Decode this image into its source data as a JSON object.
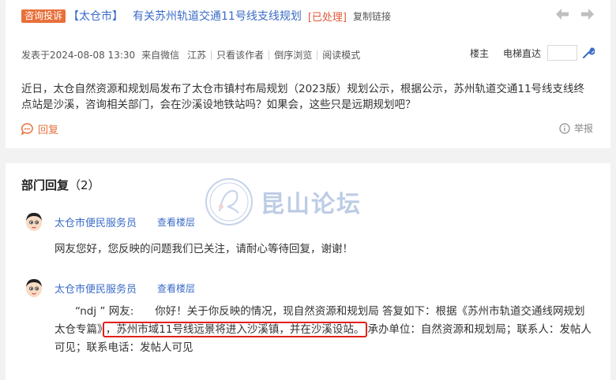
{
  "post": {
    "badge": "咨询投诉",
    "city": "【太仓市】",
    "title": "有关苏州轨道交通11号线支线规划",
    "status": "[已处理]",
    "copy_link": "复制链接",
    "meta": {
      "posted": "发表于2024-08-08 13:30",
      "source": "来自微信",
      "region": "江苏",
      "author_only": "只看该作者",
      "reverse": "倒序浏览",
      "read_mode": "阅读模式"
    },
    "floor_owner": "楼主",
    "elevator": "电梯直达",
    "content": "近日，太仓自然资源和规划局发布了太仓市镇村布局规划（2023版）规划公示，根据公示，苏州轨道交通11号线支线终点站是沙溪，咨询相关部门，会在沙溪设地铁站吗？如果会，这些只是远期规划吧？",
    "reply_label": "回复",
    "report_label": "举报"
  },
  "replies": {
    "title": "部门回复",
    "count": "（2）",
    "items": [
      {
        "author": "太仓市便民服务员",
        "view_floor": "查看楼层",
        "text": "网友您好，您反映的问题我们已关注，请耐心等待回复，谢谢！"
      },
      {
        "author": "太仓市便民服务员",
        "view_floor": "查看楼层",
        "text_prefix": "“ndj ” 网友:　　你好！关于你反映的情况，现自然资源和规划局 答复如下：根据《苏州市轨道交通线网规划太仓专篇》",
        "text_highlight": "，苏州市域11号线远景将进入沙溪镇，并在沙溪设站。",
        "text_suffix": "承办单位：自然资源和规划局；联系人：发帖人可见；联系电话：发帖人可见"
      }
    ]
  },
  "watermark": "昆山论坛",
  "colors": {
    "accent": "#e8703a",
    "link": "#3a6bc7",
    "highlight_border": "#e0201a"
  }
}
